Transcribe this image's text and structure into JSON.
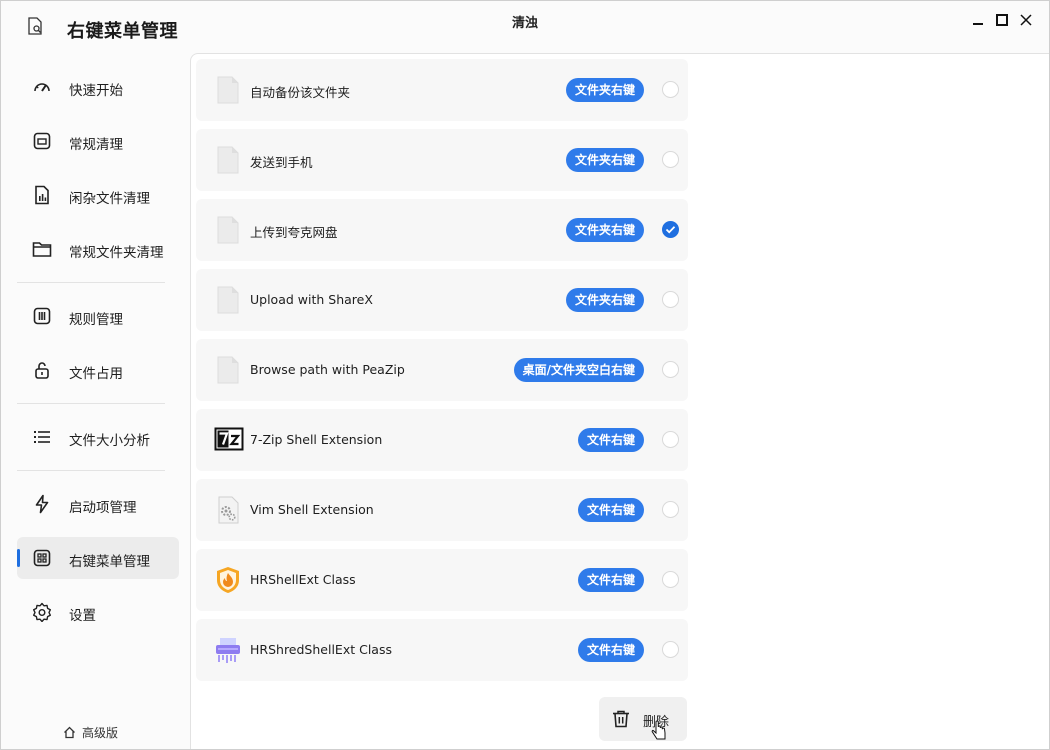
{
  "app": {
    "title": "右键菜单管理",
    "window_title": "清浊"
  },
  "sidebar": {
    "items": [
      {
        "label": "快速开始",
        "icon": "gauge-icon"
      },
      {
        "label": "常规清理",
        "icon": "cleanup-icon"
      },
      {
        "label": "闲杂文件清理",
        "icon": "file-chart-icon"
      },
      {
        "label": "常规文件夹清理",
        "icon": "folder-icon"
      },
      {
        "label": "规则管理",
        "icon": "rules-icon"
      },
      {
        "label": "文件占用",
        "icon": "unlock-icon"
      },
      {
        "label": "文件大小分析",
        "icon": "list-icon"
      },
      {
        "label": "启动项管理",
        "icon": "lightning-icon"
      },
      {
        "label": "右键菜单管理",
        "icon": "grid-icon",
        "active": true
      },
      {
        "label": "设置",
        "icon": "gear-icon"
      }
    ],
    "premium_label": "高级版"
  },
  "entries": [
    {
      "name": "自动备份该文件夹",
      "tag": "文件夹右键",
      "checked": false,
      "icon": "blank-file-icon"
    },
    {
      "name": "发送到手机",
      "tag": "文件夹右键",
      "checked": false,
      "icon": "blank-file-icon"
    },
    {
      "name": "上传到夸克网盘",
      "tag": "文件夹右键",
      "checked": true,
      "icon": "blank-file-icon"
    },
    {
      "name": "Upload with ShareX",
      "tag": "文件夹右键",
      "checked": false,
      "icon": "blank-file-icon"
    },
    {
      "name": "Browse path with PeaZip",
      "tag": "桌面/文件夹空白右键",
      "checked": false,
      "icon": "blank-file-icon"
    },
    {
      "name": "7-Zip Shell Extension",
      "tag": "文件右键",
      "checked": false,
      "icon": "7zip-icon"
    },
    {
      "name": "Vim Shell Extension",
      "tag": "文件右键",
      "checked": false,
      "icon": "gear-file-icon"
    },
    {
      "name": "HRShellExt Class",
      "tag": "文件右键",
      "checked": false,
      "icon": "shield-flame-icon"
    },
    {
      "name": "HRShredShellExt Class",
      "tag": "文件右键",
      "checked": false,
      "icon": "shredder-icon"
    }
  ],
  "actions": {
    "delete_label": "删除"
  },
  "colors": {
    "accent": "#2f7bea",
    "checked": "#1f6fe0"
  }
}
